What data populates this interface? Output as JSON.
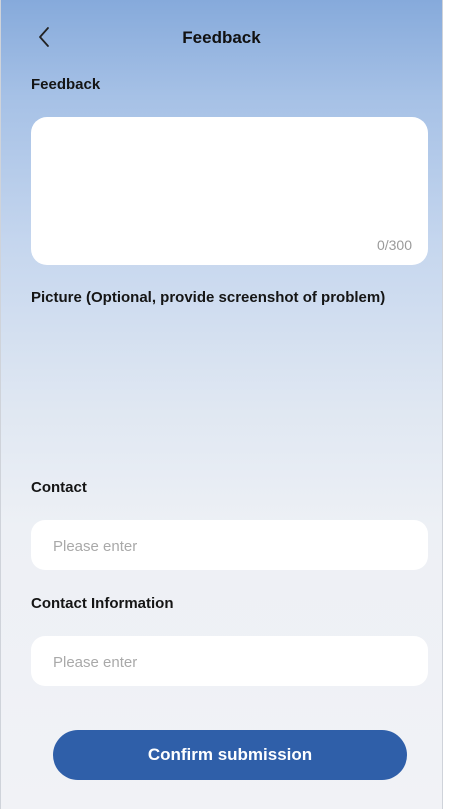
{
  "header": {
    "title": "Feedback",
    "back_icon": "chevron-left-icon"
  },
  "feedback_section": {
    "label": "Feedback",
    "value": "",
    "counter": "0/300"
  },
  "picture_section": {
    "label": "Picture (Optional, provide screenshot of problem)"
  },
  "contact_section": {
    "label": "Contact",
    "placeholder": "Please enter",
    "value": ""
  },
  "contact_info_section": {
    "label": "Contact Information",
    "placeholder": "Please enter",
    "value": ""
  },
  "submit": {
    "label": "Confirm submission",
    "color": "#2f5fa9"
  },
  "colors": {
    "gradient_top": "#86aadb",
    "background_bottom": "#f1f2f6"
  }
}
